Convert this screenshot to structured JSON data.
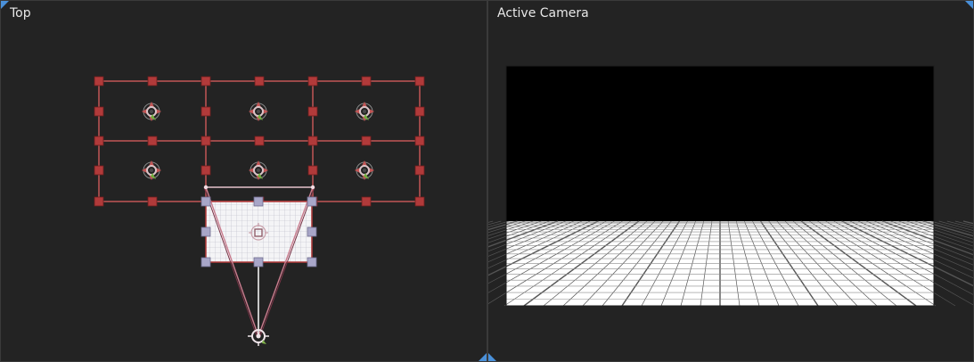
{
  "viewports": {
    "top": {
      "label": "Top"
    },
    "camera": {
      "label": "Active Camera"
    }
  },
  "colors": {
    "panel_bg": "#232323",
    "accent": "#4a90d9",
    "handle_red": "#b13a3a",
    "grid_line": "#c25656",
    "handle_lavender": "#a8a6c8",
    "sky": "#000000",
    "floor": "#ffffff"
  },
  "icons": {
    "light": "light-target-icon",
    "camera": "camera-icon",
    "plane_pivot": "pivot-icon"
  }
}
